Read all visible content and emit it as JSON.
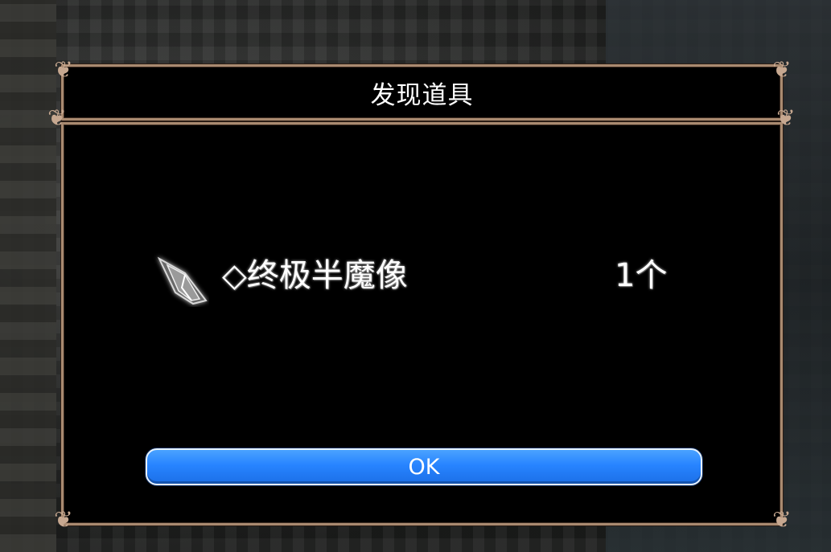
{
  "dialog": {
    "title": "发现道具",
    "item": {
      "icon": "crystal-shard-icon",
      "name": "◇终极半魔像",
      "quantity": "1个"
    },
    "ok_label": "OK"
  },
  "colors": {
    "panel_background": "#000000",
    "panel_border": "#a98a70",
    "button_blue": "#2784ff",
    "text": "#ffffff"
  }
}
